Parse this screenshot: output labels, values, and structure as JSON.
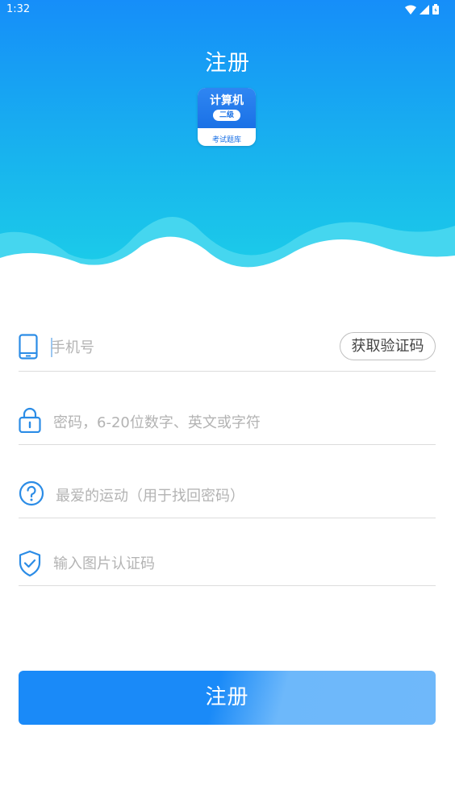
{
  "status_bar": {
    "time": "1:32"
  },
  "header": {
    "title": "注册",
    "logo": {
      "title": "计算机",
      "badge": "二级",
      "subtitle": "考试题库"
    }
  },
  "form": {
    "phone": {
      "placeholder": "手机号",
      "icon": "phone-icon",
      "code_button": "获取验证码"
    },
    "password": {
      "placeholder": "密码，6-20位数字、英文或字符",
      "icon": "lock-icon"
    },
    "security_question": {
      "placeholder": "最爱的运动（用于找回密码）",
      "icon": "question-icon"
    },
    "captcha": {
      "placeholder": "输入图片认证码",
      "icon": "shield-check-icon"
    }
  },
  "submit_label": "注册",
  "colors": {
    "primary": "#168ef9",
    "header_bottom": "#1ccfe8",
    "accent": "#2b8ce6"
  }
}
